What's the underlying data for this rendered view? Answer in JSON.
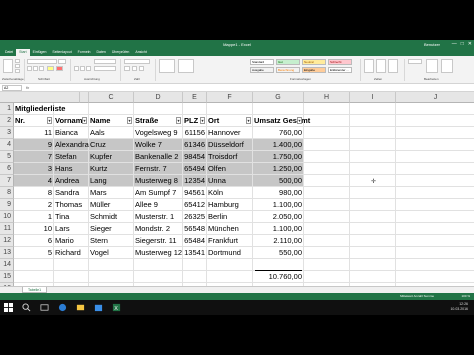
{
  "titlebar": {
    "title": "Mappe1 - Excel",
    "user": "Benutzer",
    "min": "—",
    "max": "□",
    "close": "✕"
  },
  "tabs": [
    "Datei",
    "Start",
    "Einfügen",
    "Seitenlayout",
    "Formeln",
    "Daten",
    "Überprüfen",
    "Ansicht"
  ],
  "active_tab": "Start",
  "ribbon": {
    "styles": [
      "Standard",
      "Gut",
      "Neutral",
      "Schlecht",
      "Ausgabe",
      "Berechnung",
      "Eingabe",
      "Erklärender ..."
    ],
    "groups": [
      "Zwischenablage",
      "Schriftart",
      "Ausrichtung",
      "Zahl",
      "Formatvorlagen",
      "Zellen",
      "Bearbeiten"
    ]
  },
  "formula_bar": {
    "name_box": "A2",
    "fx": "fx"
  },
  "columns": [
    "A",
    "B",
    "C",
    "D",
    "E",
    "F",
    "G",
    "H",
    "I",
    "J"
  ],
  "rows": [
    "1",
    "2",
    "3",
    "4",
    "5",
    "6",
    "7",
    "8",
    "9",
    "10",
    "11",
    "12",
    "13",
    "14",
    "15",
    "16"
  ],
  "sheet": {
    "title": "Mitgliederliste",
    "headers": [
      "Nr.",
      "Vorname",
      "Name",
      "Straße",
      "PLZ",
      "Ort",
      "Umsatz Gesamt"
    ],
    "records": [
      [
        "11",
        "Bianca",
        "Aals",
        "Vogelsweg 9",
        "61156",
        "Hannover",
        "760,00"
      ],
      [
        "9",
        "Alexandra",
        "Cruz",
        "Wolke 7",
        "61346",
        "Düsseldorf",
        "1.400,00"
      ],
      [
        "7",
        "Stefan",
        "Kupfer",
        "Bankenalle 2",
        "98454",
        "Troisdorf",
        "1.750,00"
      ],
      [
        "3",
        "Hans",
        "Kurtz",
        "Fernstr. 7",
        "65494",
        "Olfen",
        "1.250,00"
      ],
      [
        "4",
        "Andrea",
        "Lang",
        "Musterweg 8",
        "12354",
        "Unna",
        "500,00"
      ],
      [
        "8",
        "Sandra",
        "Mars",
        "Am Sumpf 7",
        "94561",
        "Köln",
        "980,00"
      ],
      [
        "2",
        "Thomas",
        "Müller",
        "Allee 9",
        "65412",
        "Hamburg",
        "1.100,00"
      ],
      [
        "1",
        "Tina",
        "Schmidt",
        "Musterstr. 1",
        "26325",
        "Berlin",
        "2.050,00"
      ],
      [
        "10",
        "Lars",
        "Sieger",
        "Mondstr. 2",
        "56548",
        "München",
        "1.100,00"
      ],
      [
        "6",
        "Mario",
        "Stern",
        "Siegerstr. 11",
        "65484",
        "Frankfurt",
        "2.110,00"
      ],
      [
        "5",
        "Richard",
        "Vogel",
        "Musterweg 12",
        "13541",
        "Dortmund",
        "550,00"
      ]
    ],
    "total": "10.760,00"
  },
  "sheet_tab": "Tabelle1",
  "status": {
    "stats": "Mittelwert  Anzahl  Summe",
    "zoom": "100 %"
  },
  "clock": {
    "time": "12:26",
    "date": "10.03.2016"
  },
  "colors": {
    "excel_green": "#217346",
    "selection": "#c6c6c6"
  }
}
